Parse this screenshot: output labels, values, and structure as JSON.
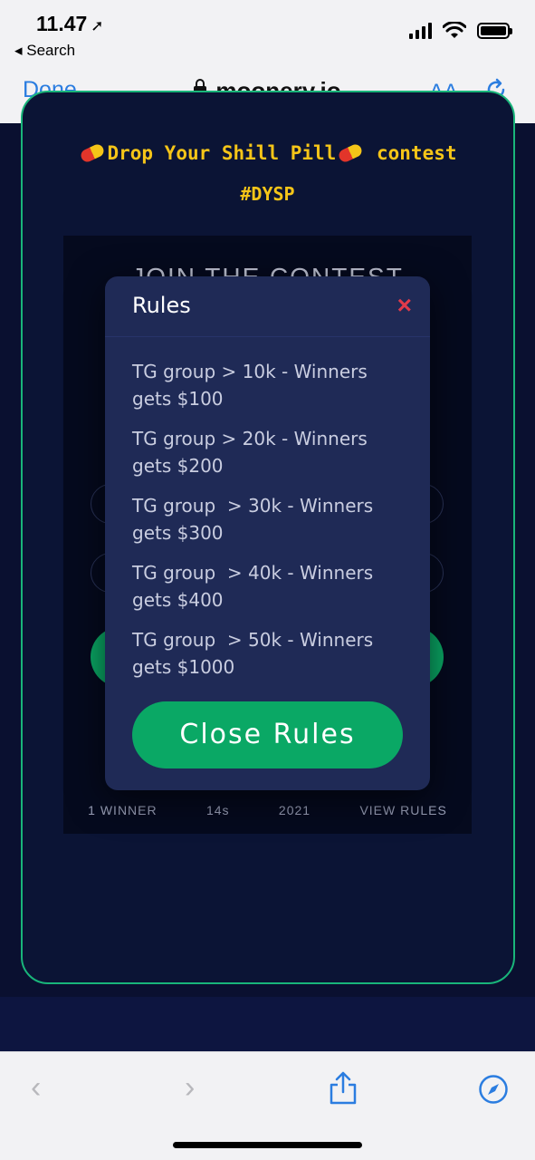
{
  "status_bar": {
    "time": "11.47",
    "back_label": "◂ Search"
  },
  "browser": {
    "done_label": "Done",
    "url": "moonery.io",
    "aa_label": "AA"
  },
  "page": {
    "promo_text": "Drop Your Shill Pill",
    "promo_suffix": "contest",
    "hashtag": "#DYSP",
    "contest_heading": "JOIN THE CONTEST",
    "stats": [
      {
        "label": "1 WINNER"
      },
      {
        "label": "14s"
      },
      {
        "label": "2021"
      },
      {
        "label": "VIEW RULES"
      }
    ]
  },
  "modal": {
    "title": "Rules",
    "close_icon": "×",
    "rules": [
      "TG group > 10k - Winners gets $100",
      "TG group > 20k - Winners gets $200",
      "TG group  > 30k - Winners gets $300",
      "TG group  > 40k - Winners gets $400",
      "TG group  > 50k - Winners gets $1000"
    ],
    "close_button_label": "Close Rules"
  },
  "colors": {
    "accent_green": "#0aa865",
    "promo_yellow": "#f5c518",
    "close_red": "#e23a4a",
    "modal_bg": "#1f2a56",
    "link_blue": "#2b7de0"
  }
}
